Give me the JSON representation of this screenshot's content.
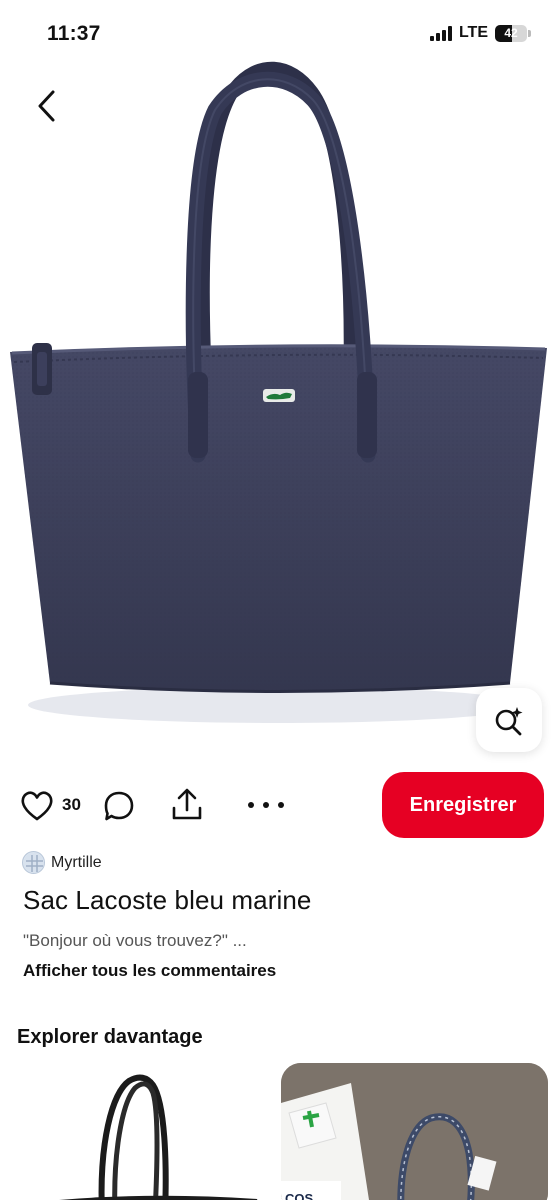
{
  "status_bar": {
    "time": "11:37",
    "network": "LTE",
    "battery_level": "42"
  },
  "pin": {
    "image_icon": "navy-tote-bag-photo",
    "like_count": "30",
    "save_label": "Enregistrer",
    "author": "Myrtille",
    "title": "Sac Lacoste bleu marine",
    "comment_preview": "\"Bonjour où vous trouvez?\" ...",
    "all_comments_label": "Afficher tous les commentaires"
  },
  "explore": {
    "title": "Explorer davantage",
    "cards": [
      {
        "icon": "black-tote-bag-thumbnail"
      },
      {
        "icon": "navy-tote-with-packaging-thumbnail"
      }
    ]
  },
  "colors": {
    "accent": "#e60023",
    "bag": "#3b3e5c"
  }
}
